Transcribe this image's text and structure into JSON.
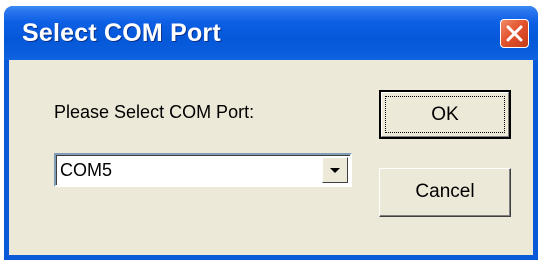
{
  "window": {
    "title": "Select COM Port",
    "close_icon": "close-icon",
    "colors": {
      "titlebar": "#0458d8",
      "close_button": "#e2552e",
      "client_background": "#ece9d8"
    }
  },
  "form": {
    "prompt_label": "Please Select COM Port:",
    "com_port_select": {
      "selected_value": "COM5",
      "arrow_icon": "dropdown-arrow-icon"
    }
  },
  "buttons": {
    "ok_label": "OK",
    "cancel_label": "Cancel"
  }
}
